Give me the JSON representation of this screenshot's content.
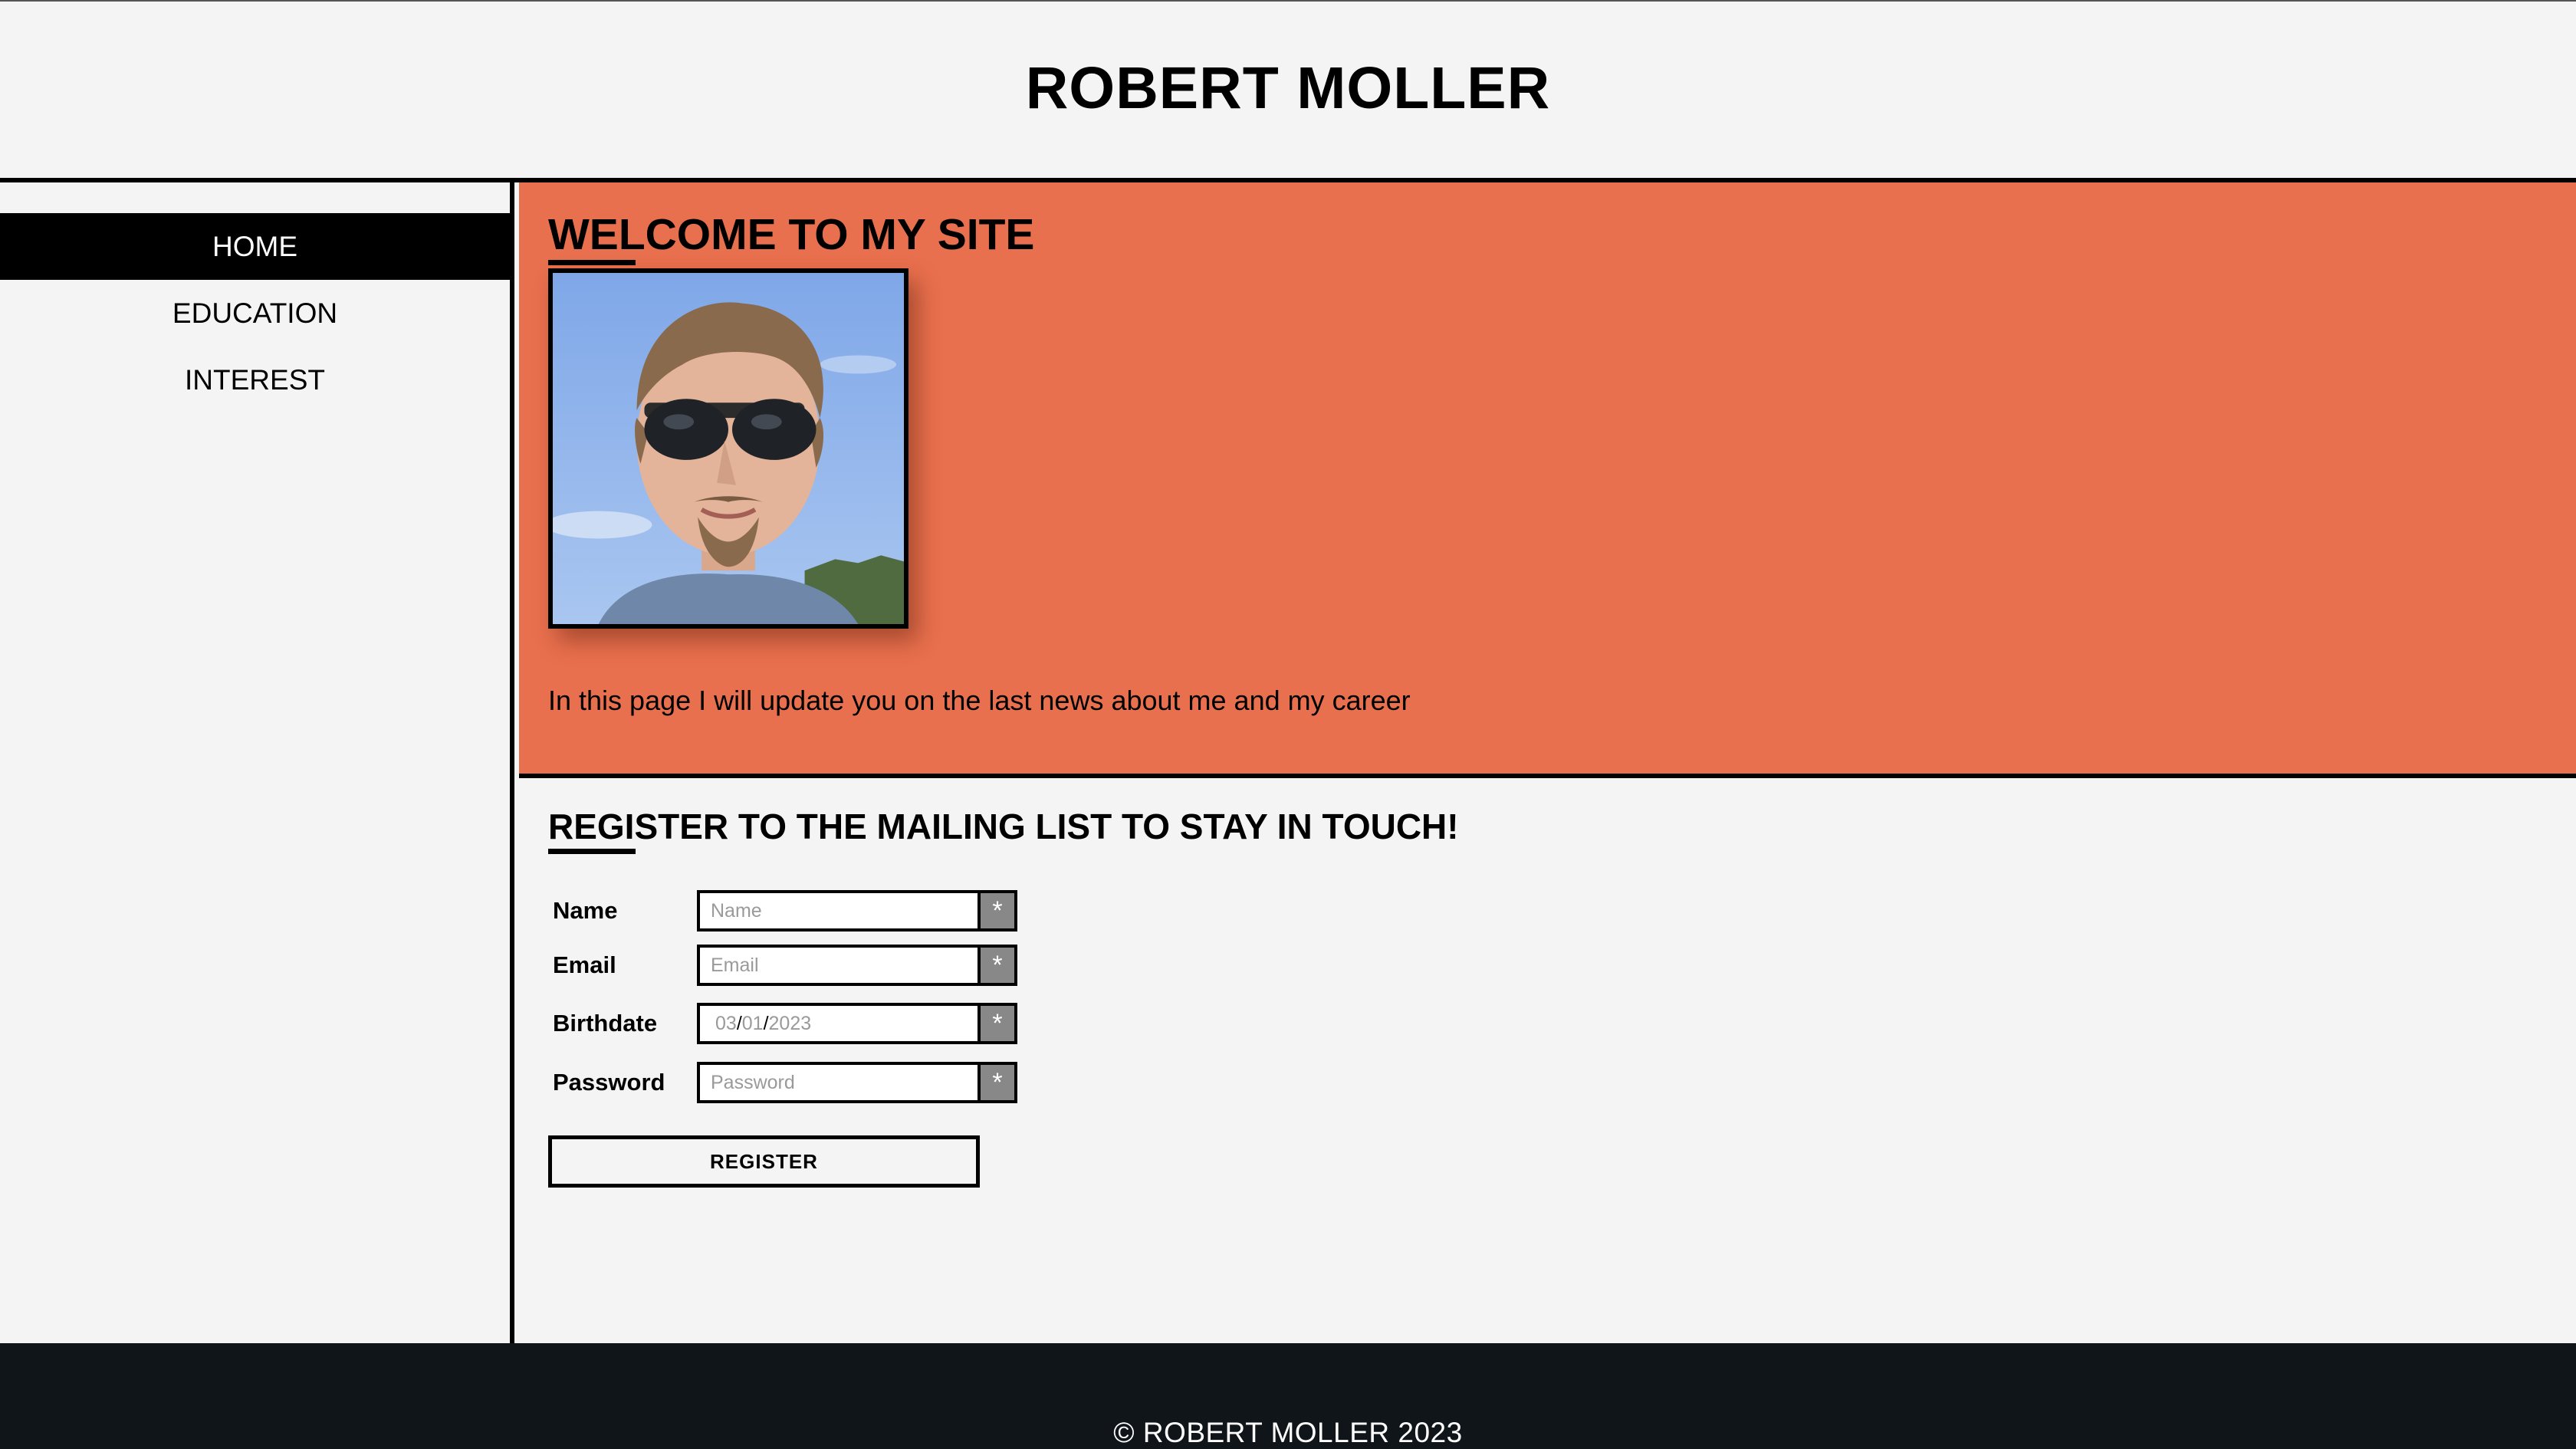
{
  "header": {
    "title": "ROBERT MOLLER"
  },
  "sidebar": {
    "items": [
      {
        "label": "HOME",
        "active": true
      },
      {
        "label": "EDUCATION",
        "active": false
      },
      {
        "label": "INTEREST",
        "active": false
      }
    ]
  },
  "welcome": {
    "title": "WELCOME TO MY SITE",
    "text": "In this page I will update you on the last news about me and my career",
    "background_color": "#e9704e"
  },
  "register": {
    "title": "REGISTER TO THE MAILING LIST TO STAY IN TOUCH!",
    "fields": [
      {
        "label": "Name",
        "placeholder": "Name"
      },
      {
        "label": "Email",
        "placeholder": "Email"
      },
      {
        "label": "Birthdate",
        "month": "03",
        "day": "01",
        "year": "2023"
      },
      {
        "label": "Password",
        "placeholder": "Password"
      }
    ],
    "required_mark": "*",
    "button_label": "REGISTER"
  },
  "footer": {
    "text": "© ROBERT MOLLER 2023",
    "background_color": "#0f1519"
  }
}
